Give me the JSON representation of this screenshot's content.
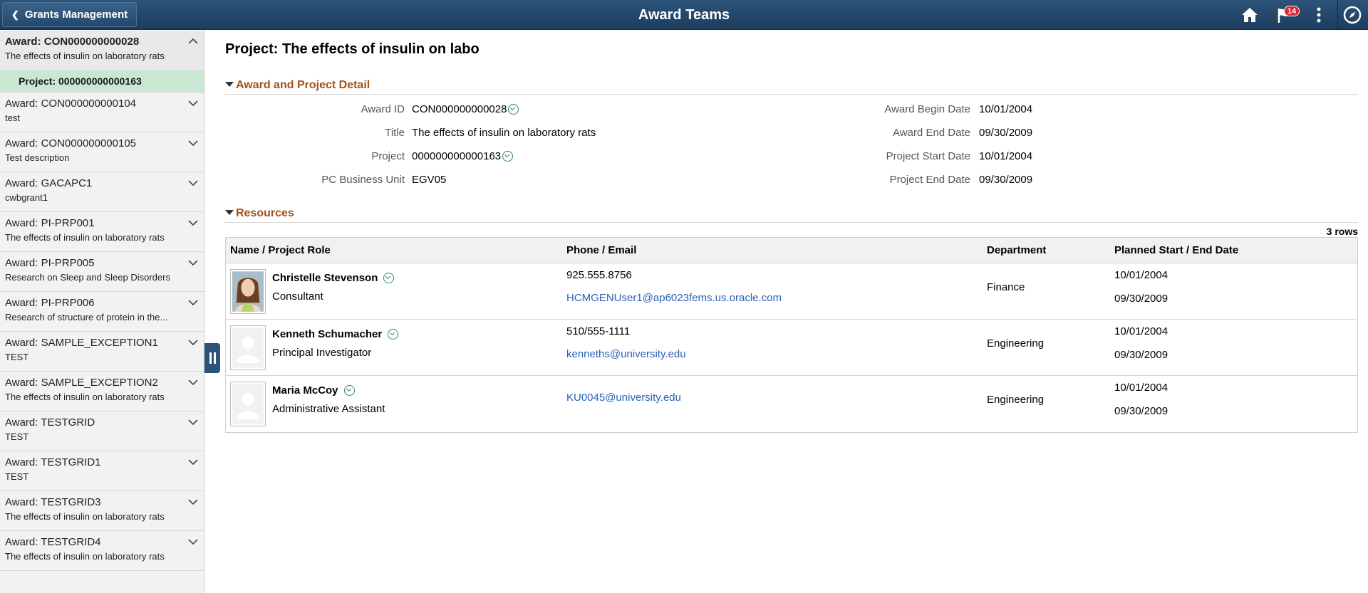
{
  "header": {
    "back_label": "Grants Management",
    "title": "Award Teams",
    "notification_count": "14"
  },
  "sidebar": {
    "selected_award": {
      "title": "Award: CON000000000028",
      "desc": "The effects of insulin on laboratory rats"
    },
    "selected_project": "Project: 000000000000163",
    "awards": [
      {
        "title": "Award: CON000000000104",
        "desc": "test"
      },
      {
        "title": "Award: CON000000000105",
        "desc": "Test description"
      },
      {
        "title": "Award: GACAPC1",
        "desc": "cwbgrant1"
      },
      {
        "title": "Award: PI-PRP001",
        "desc": "The effects of insulin on laboratory rats"
      },
      {
        "title": "Award: PI-PRP005",
        "desc": "Research on Sleep and Sleep Disorders"
      },
      {
        "title": "Award: PI-PRP006",
        "desc": "Research of structure of protein in the..."
      },
      {
        "title": "Award: SAMPLE_EXCEPTION1",
        "desc": "TEST"
      },
      {
        "title": "Award: SAMPLE_EXCEPTION2",
        "desc": "The effects of insulin on laboratory rats"
      },
      {
        "title": "Award: TESTGRID",
        "desc": "TEST"
      },
      {
        "title": "Award: TESTGRID1",
        "desc": "TEST"
      },
      {
        "title": "Award: TESTGRID3",
        "desc": "The effects of insulin on laboratory rats"
      },
      {
        "title": "Award: TESTGRID4",
        "desc": "The effects of insulin on laboratory rats"
      }
    ]
  },
  "main": {
    "project_title": "Project: The effects of insulin on labo",
    "detail_section": "Award and Project Detail",
    "details_left": [
      {
        "label": "Award ID",
        "value": "CON000000000028",
        "has_related": true
      },
      {
        "label": "Title",
        "value": "The effects of insulin on laboratory rats",
        "has_related": false
      },
      {
        "label": "Project",
        "value": "000000000000163",
        "has_related": true
      },
      {
        "label": "PC Business Unit",
        "value": "EGV05",
        "has_related": false
      }
    ],
    "details_right": [
      {
        "label": "Award Begin Date",
        "value": "10/01/2004"
      },
      {
        "label": "Award End Date",
        "value": "09/30/2009"
      },
      {
        "label": "Project Start Date",
        "value": "10/01/2004"
      },
      {
        "label": "Project End Date",
        "value": "09/30/2009"
      }
    ],
    "resources_section": "Resources",
    "row_count": "3 rows",
    "columns": [
      "Name / Project Role",
      "Phone / Email",
      "Department",
      "Planned Start / End Date"
    ],
    "rows": [
      {
        "name": "Christelle Stevenson",
        "role": "Consultant",
        "phone": "925.555.8756",
        "email": "HCMGENUser1@ap6023fems.us.oracle.com",
        "department": "Finance",
        "start": "10/01/2004",
        "end": "09/30/2009",
        "photo": "photo"
      },
      {
        "name": "Kenneth Schumacher",
        "role": "Principal Investigator",
        "phone": "510/555-1111",
        "email": "kenneths@university.edu",
        "department": "Engineering",
        "start": "10/01/2004",
        "end": "09/30/2009",
        "photo": "placeholder"
      },
      {
        "name": "Maria McCoy",
        "role": "Administrative Assistant",
        "phone": "",
        "email": "KU0045@university.edu",
        "department": "Engineering",
        "start": "10/01/2004",
        "end": "09/30/2009",
        "photo": "placeholder"
      }
    ]
  }
}
